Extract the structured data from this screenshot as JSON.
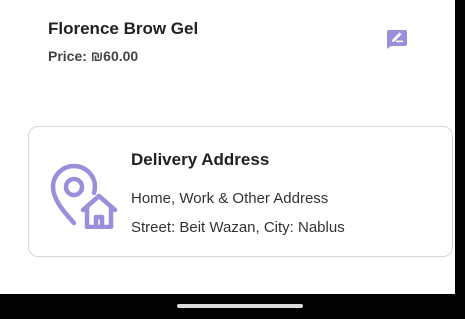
{
  "product": {
    "name": "Florence Brow Gel",
    "price": "Price: ₪60.00"
  },
  "edit_icon": "edit-note-icon",
  "delivery": {
    "title": "Delivery Address",
    "subtitle": "Home, Work & Other Address",
    "address": "Street: Beit Wazan, City: Nablus",
    "icon": "location-home-icon"
  },
  "colors": {
    "accent": "#9b8fdc",
    "border": "#d7d7d7",
    "text": "#222222"
  }
}
